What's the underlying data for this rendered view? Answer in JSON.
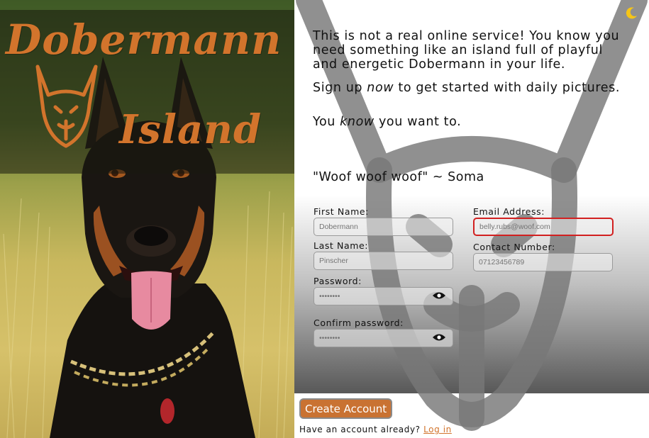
{
  "hero": {
    "logo_word_1": "Dobermann",
    "logo_word_2": "Island"
  },
  "intro": {
    "paragraph_1": "This is not a real online service! You know you need something like an island full of playful and energetic Dobermann in your life.",
    "paragraph_2_pre": "Sign up ",
    "paragraph_2_em": "now",
    "paragraph_2_post": " to get started with daily pictures.",
    "paragraph_3_pre": "You ",
    "paragraph_3_em": "know",
    "paragraph_3_post": " you want to.",
    "quote": "\"Woof woof woof\" ~ Soma"
  },
  "form": {
    "first_name": {
      "label": "First Name:",
      "placeholder": "Dobermann"
    },
    "last_name": {
      "label": "Last Name:",
      "placeholder": "Pinscher"
    },
    "password": {
      "label": "Password:",
      "placeholder": "••••••••"
    },
    "confirm_password": {
      "label": "Confirm password:",
      "placeholder": "••••••••"
    },
    "email": {
      "label": "Email Address:",
      "placeholder": "belly.rubs@woof.com"
    },
    "contact": {
      "label": "Contact Number:",
      "placeholder": "07123456789"
    },
    "submit_label": "Create Account",
    "login_prompt": "Have an account already? ",
    "login_link": "Log in"
  },
  "colors": {
    "accent": "#d2742c",
    "invalid_border": "#d22020",
    "toggle_icon": "#f5c518"
  },
  "icons": [
    "moon-icon",
    "eye-icon",
    "dobermann-head-logo"
  ]
}
